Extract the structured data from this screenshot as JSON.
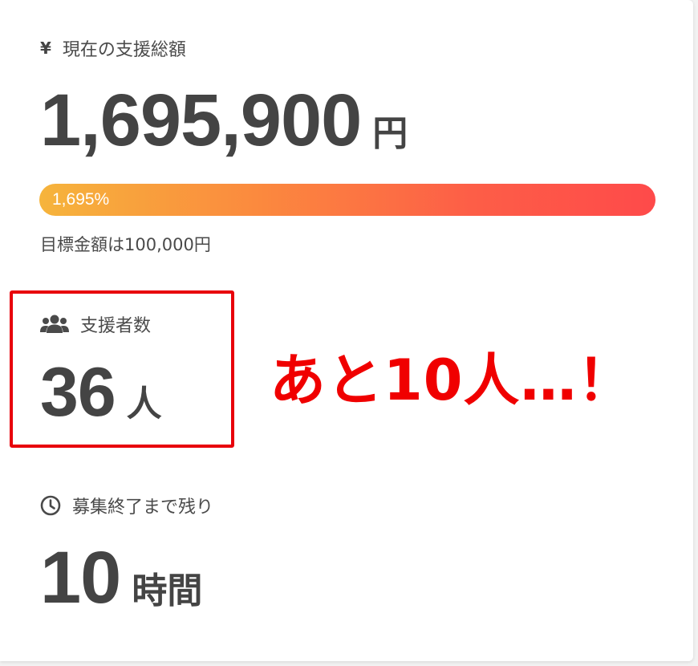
{
  "funding": {
    "label": "現在の支援総額",
    "icon": "yen-icon",
    "amount": "1,695,900",
    "unit": "円"
  },
  "progress": {
    "text": "1,695%",
    "percent": 1695
  },
  "goal": {
    "text": "目標金額は100,000円"
  },
  "supporters": {
    "label": "支援者数",
    "icon": "people-icon",
    "count": "36",
    "unit": "人"
  },
  "time_left": {
    "label": "募集終了まで残り",
    "icon": "clock-icon",
    "value": "10",
    "unit": "時間"
  },
  "annotation": {
    "text": "あと10人…！",
    "color": "#f00000"
  }
}
